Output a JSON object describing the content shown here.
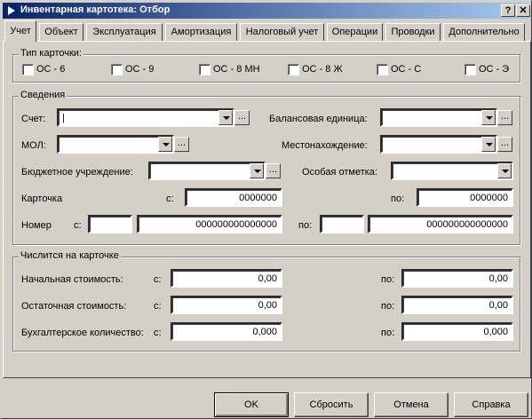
{
  "window": {
    "title": "Инвентарная картотека: Отбор",
    "help_btn": "?",
    "close_btn": "X"
  },
  "tabs": [
    {
      "label": "Учет",
      "active": true
    },
    {
      "label": "Объект"
    },
    {
      "label": "Эксплуатация"
    },
    {
      "label": "Амортизация"
    },
    {
      "label": "Налоговый учет"
    },
    {
      "label": "Операции"
    },
    {
      "label": "Проводки"
    },
    {
      "label": "Дополнительно"
    }
  ],
  "card_type": {
    "legend": "Тип карточки:",
    "options": [
      {
        "label": "ОС - 6",
        "checked": false
      },
      {
        "label": "ОС - 9",
        "checked": false
      },
      {
        "label": "ОС - 8 МН",
        "checked": false
      },
      {
        "label": "ОС - 8 Ж",
        "checked": false
      },
      {
        "label": "ОС - С",
        "checked": false
      },
      {
        "label": "ОС - Э",
        "checked": false
      }
    ]
  },
  "info": {
    "legend": "Сведения",
    "account_label": "Счет:",
    "account_value": "|",
    "balance_unit_label": "Балансовая единица:",
    "mol_label": "МОЛ:",
    "location_label": "Местонахождение:",
    "budget_label": "Бюджетное учреждение:",
    "special_mark_label": "Особая отметка:",
    "card_label": "Карточка",
    "from_label": "с:",
    "to_label": "по:",
    "card_from": "0000000",
    "card_to": "0000000",
    "number_label": "Номер",
    "number_from_prefix": "",
    "number_from": "000000000000000",
    "number_to_prefix": "",
    "number_to": "000000000000000"
  },
  "listed": {
    "legend": "Числится на карточке",
    "rows": [
      {
        "label": "Начальная стоимость:",
        "from": "0,00",
        "to": "0,00"
      },
      {
        "label": "Остаточная стоимость:",
        "from": "0,00",
        "to": "0,00"
      },
      {
        "label": "Бухгалтерское количество:",
        "from": "0,000",
        "to": "0,000"
      }
    ],
    "from_label": "с:",
    "to_label": "по:"
  },
  "buttons": {
    "ok": "OK",
    "reset": "Сбросить",
    "cancel": "Отмена",
    "help": "Справка"
  }
}
